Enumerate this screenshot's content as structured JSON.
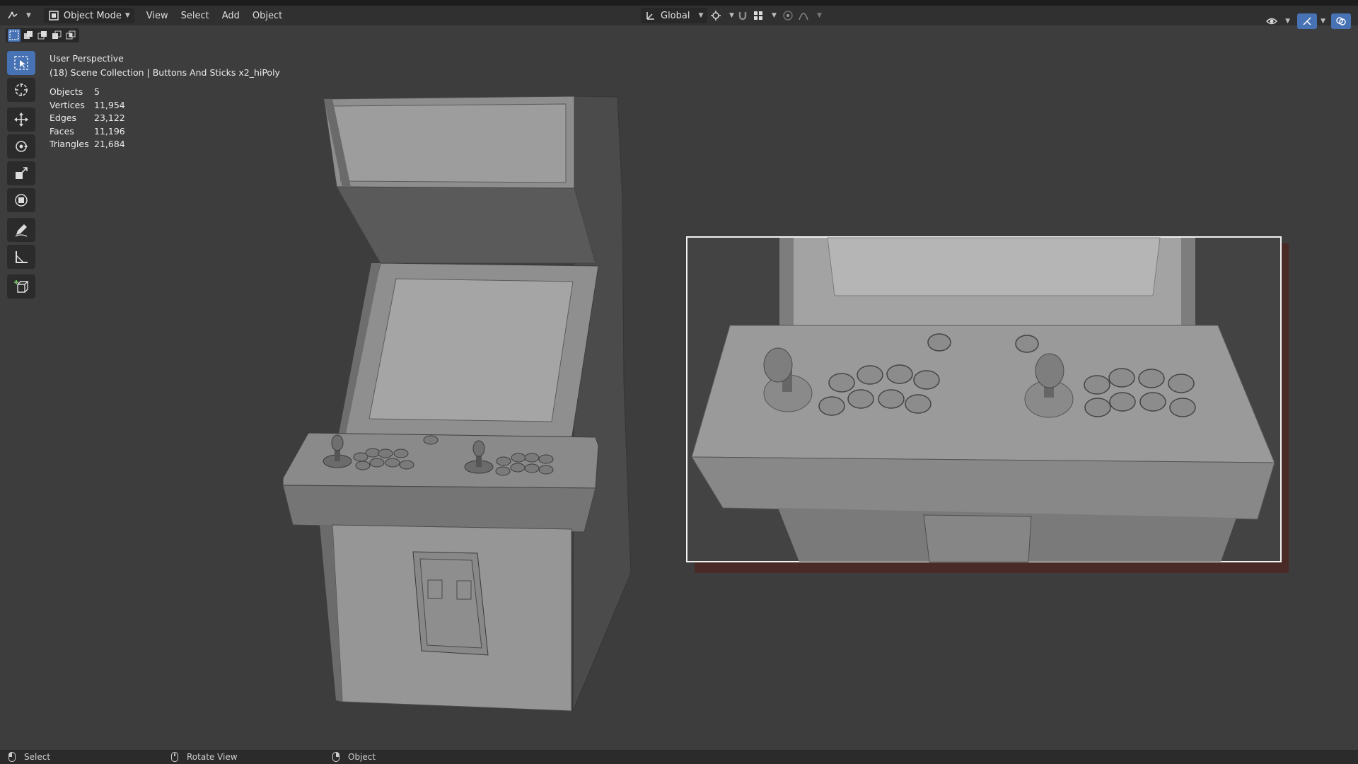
{
  "header": {
    "mode_label": "Object Mode",
    "menus": [
      "View",
      "Select",
      "Add",
      "Object"
    ],
    "orientation_label": "Global"
  },
  "viewport": {
    "view_name": "User Perspective",
    "collection_line": "(18) Scene Collection | Buttons And Sticks x2_hiPoly",
    "stats": [
      {
        "label": "Objects",
        "value": "5"
      },
      {
        "label": "Vertices",
        "value": "11,954"
      },
      {
        "label": "Edges",
        "value": "23,122"
      },
      {
        "label": "Faces",
        "value": "11,196"
      },
      {
        "label": "Triangles",
        "value": "21,684"
      }
    ]
  },
  "toolbar": {
    "tools": [
      "select-box-tool",
      "cursor-tool",
      "move-tool",
      "rotate-tool",
      "scale-tool",
      "transform-tool",
      "annotate-tool",
      "measure-tool",
      "add-cube-tool"
    ]
  },
  "statusbar": {
    "items": [
      {
        "label": "Select"
      },
      {
        "label": "Rotate View"
      },
      {
        "label": "Object"
      }
    ]
  },
  "colors": {
    "accent": "#4772b3",
    "background": "#3d3d3d",
    "header": "#303030",
    "inset_shadow": "#4a2a26"
  }
}
